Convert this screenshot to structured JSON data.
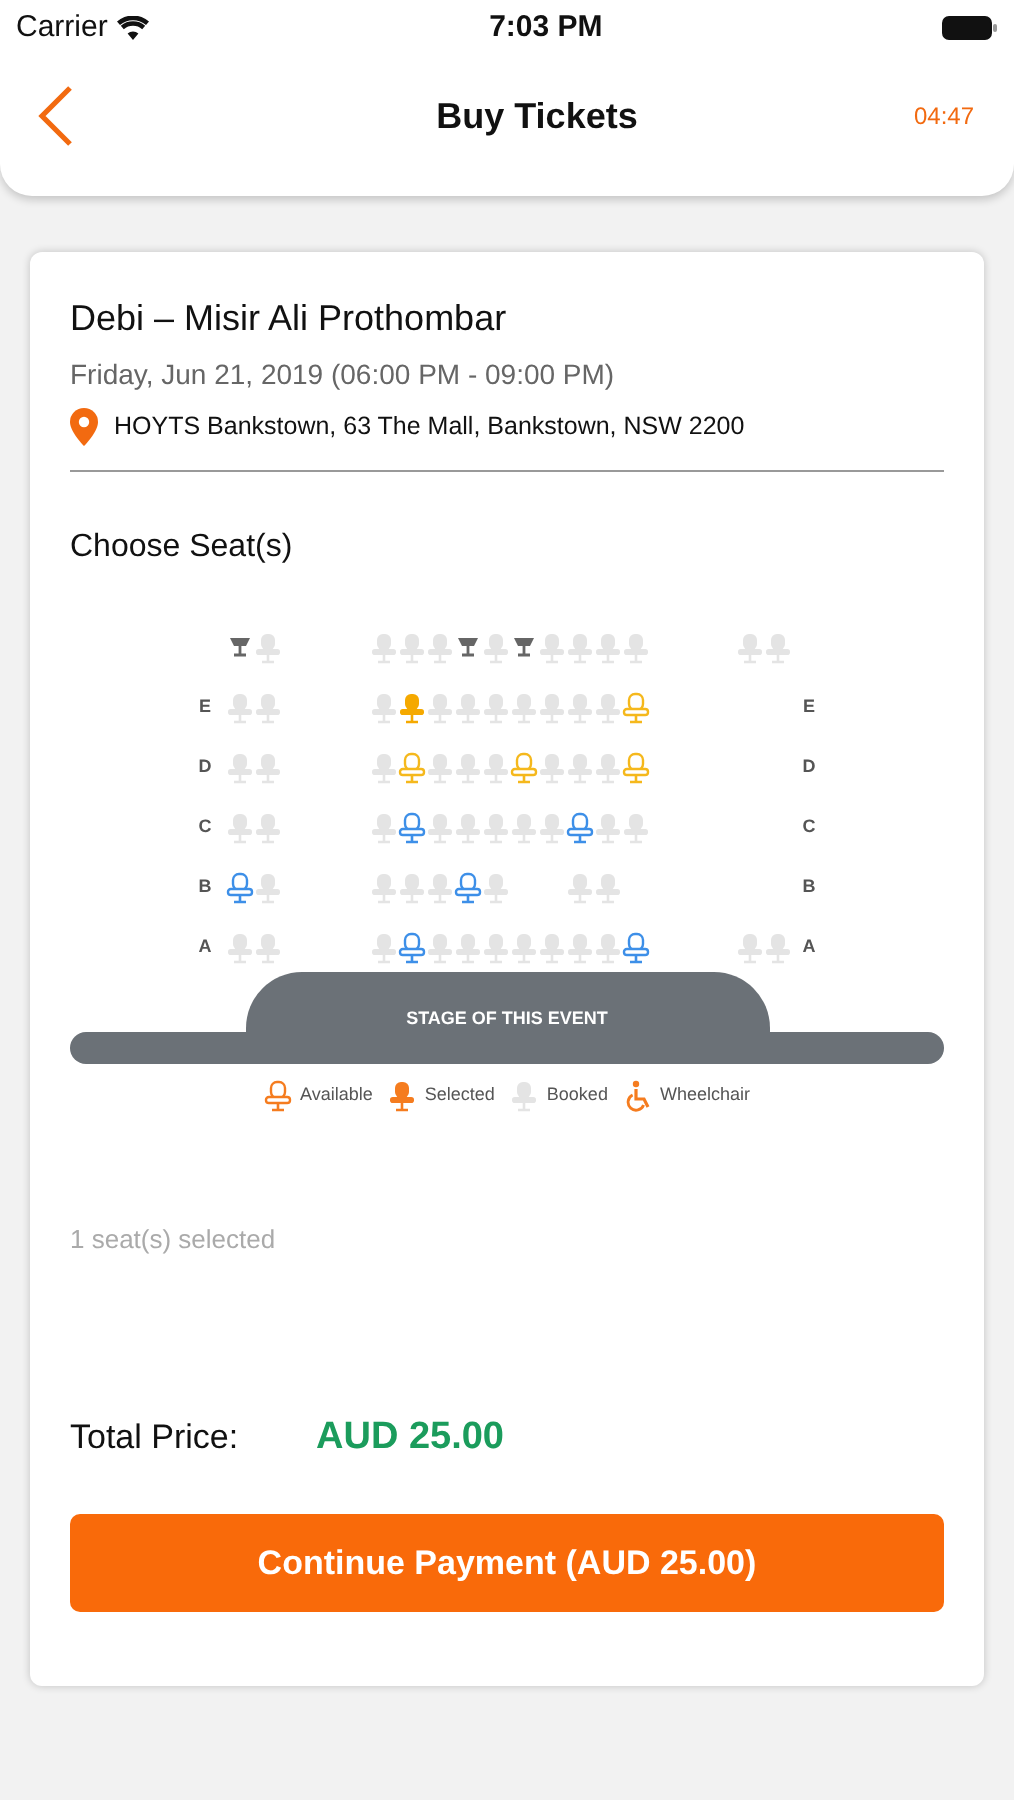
{
  "status_bar": {
    "carrier": "Carrier",
    "time": "7:03 PM"
  },
  "header": {
    "title": "Buy Tickets",
    "timer": "04:47"
  },
  "event": {
    "title": "Debi – Misir Ali Prothombar",
    "date": "Friday, Jun 21, 2019 (06:00 PM - 09:00 PM)",
    "venue": "HOYTS Bankstown, 63 The Mall, Bankstown, NSW 2200"
  },
  "seat_heading": "Choose Seat(s)",
  "seat_map": {
    "rows": [
      {
        "left": [
          {
            "kind": "wheelchair"
          },
          {
            "kind": "booked"
          }
        ],
        "middle": [
          {
            "kind": "booked"
          },
          {
            "kind": "booked"
          },
          {
            "kind": "booked"
          },
          {
            "kind": "wheelchair"
          },
          {
            "kind": "booked"
          },
          {
            "kind": "wheelchair"
          },
          {
            "kind": "booked"
          },
          {
            "kind": "booked"
          },
          {
            "kind": "booked"
          },
          {
            "kind": "booked"
          }
        ],
        "right": [
          {
            "kind": "booked"
          },
          {
            "kind": "booked"
          }
        ]
      },
      {
        "label_left": "E",
        "label_right": "E",
        "left": [
          {
            "kind": "booked"
          },
          {
            "kind": "booked"
          }
        ],
        "middle": [
          {
            "kind": "booked"
          },
          {
            "kind": "selected",
            "color": "#f5a900"
          },
          {
            "kind": "booked"
          },
          {
            "kind": "booked"
          },
          {
            "kind": "booked"
          },
          {
            "kind": "booked"
          },
          {
            "kind": "booked"
          },
          {
            "kind": "booked"
          },
          {
            "kind": "booked"
          },
          {
            "kind": "available",
            "color": "#f5b81c"
          }
        ],
        "right": []
      },
      {
        "label_left": "D",
        "label_right": "D",
        "left": [
          {
            "kind": "booked"
          },
          {
            "kind": "booked"
          }
        ],
        "middle": [
          {
            "kind": "booked"
          },
          {
            "kind": "available",
            "color": "#f5b81c"
          },
          {
            "kind": "booked"
          },
          {
            "kind": "booked"
          },
          {
            "kind": "booked"
          },
          {
            "kind": "available",
            "color": "#f5b81c"
          },
          {
            "kind": "booked"
          },
          {
            "kind": "booked"
          },
          {
            "kind": "booked"
          },
          {
            "kind": "available",
            "color": "#f5b81c"
          }
        ],
        "right": []
      },
      {
        "label_left": "C",
        "label_right": "C",
        "left": [
          {
            "kind": "booked"
          },
          {
            "kind": "booked"
          }
        ],
        "middle": [
          {
            "kind": "booked"
          },
          {
            "kind": "available",
            "color": "#3d8fe8"
          },
          {
            "kind": "booked"
          },
          {
            "kind": "booked"
          },
          {
            "kind": "booked"
          },
          {
            "kind": "booked"
          },
          {
            "kind": "booked"
          },
          {
            "kind": "available",
            "color": "#3d8fe8"
          },
          {
            "kind": "booked"
          },
          {
            "kind": "booked"
          }
        ],
        "right": []
      },
      {
        "label_left": "B",
        "label_right": "B",
        "left": [
          {
            "kind": "available",
            "color": "#3d8fe8"
          },
          {
            "kind": "booked"
          }
        ],
        "middle": [
          {
            "kind": "booked"
          },
          {
            "kind": "booked"
          },
          {
            "kind": "booked"
          },
          {
            "kind": "available",
            "color": "#3d8fe8"
          },
          {
            "kind": "booked"
          },
          {
            "kind": "gap"
          },
          {
            "kind": "gap"
          },
          {
            "kind": "booked"
          },
          {
            "kind": "booked"
          },
          {
            "kind": "gap"
          }
        ],
        "right": []
      },
      {
        "label_left": "A",
        "label_right": "A",
        "left": [
          {
            "kind": "booked"
          },
          {
            "kind": "booked"
          }
        ],
        "middle": [
          {
            "kind": "booked"
          },
          {
            "kind": "available",
            "color": "#3d8fe8"
          },
          {
            "kind": "booked"
          },
          {
            "kind": "booked"
          },
          {
            "kind": "booked"
          },
          {
            "kind": "booked"
          },
          {
            "kind": "booked"
          },
          {
            "kind": "booked"
          },
          {
            "kind": "booked"
          },
          {
            "kind": "available",
            "color": "#3d8fe8"
          }
        ],
        "right": [
          {
            "kind": "booked"
          },
          {
            "kind": "booked"
          }
        ]
      }
    ],
    "stage": "STAGE OF THIS EVENT",
    "legend": [
      {
        "kind": "available",
        "label": "Available"
      },
      {
        "kind": "selected",
        "label": "Selected"
      },
      {
        "kind": "booked",
        "label": "Booked"
      },
      {
        "kind": "wheelchair",
        "label": "Wheelchair"
      }
    ]
  },
  "selection_note": "1 seat(s) selected",
  "total": {
    "label": "Total Price:",
    "amount": "AUD 25.00"
  },
  "button": "Continue Payment (AUD 25.00)"
}
